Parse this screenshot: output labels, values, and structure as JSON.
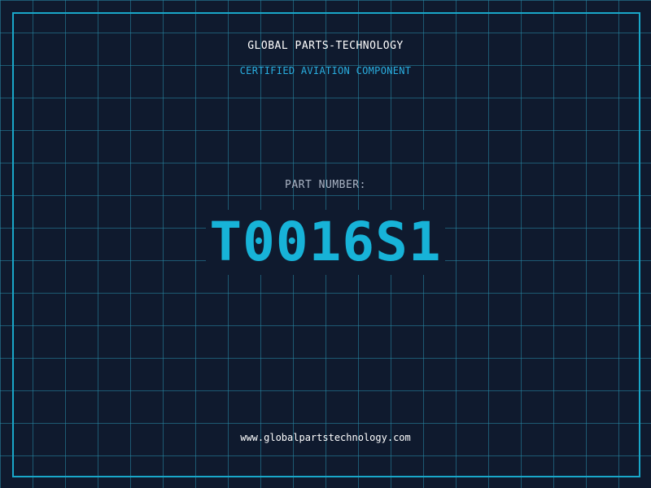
{
  "header": {
    "company": "GLOBAL PARTS-TECHNOLOGY",
    "subtitle": "CERTIFIED AVIATION COMPONENT"
  },
  "part": {
    "label": "PART NUMBER:",
    "number": "T0016S1"
  },
  "footer": {
    "url": "www.globalpartstechnology.com"
  },
  "colors": {
    "background": "#0f1a2e",
    "grid": "#288caa",
    "frame": "#19a7c9",
    "accent": "#17b3d8",
    "subtitle": "#29aee0",
    "label": "#aab4c4",
    "text": "#ffffff"
  }
}
